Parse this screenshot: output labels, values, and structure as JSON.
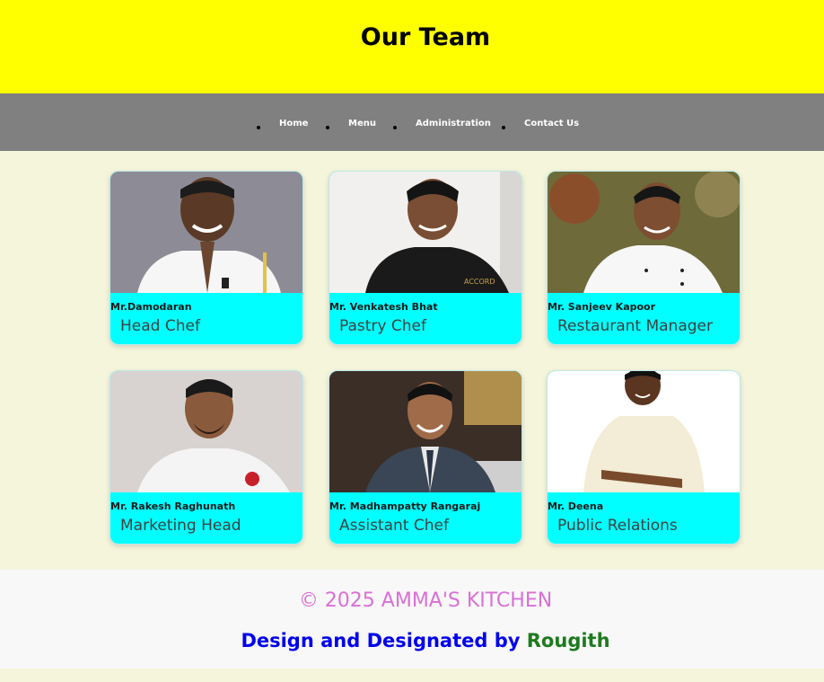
{
  "header": {
    "title": "Our Team",
    "background": "#ffff00"
  },
  "nav": {
    "background": "#808080",
    "items": [
      {
        "label": "Home"
      },
      {
        "label": "Menu"
      },
      {
        "label": "Administration"
      },
      {
        "label": "Contact Us"
      }
    ]
  },
  "team": [
    {
      "name": "Mr.Damodaran",
      "role": "Head Chef"
    },
    {
      "name": "Mr. Venkatesh Bhat",
      "role": "Pastry Chef"
    },
    {
      "name": "Mr. Sanjeev Kapoor",
      "role": "Restaurant Manager"
    },
    {
      "name": "Mr. Rakesh Raghunath",
      "role": "Marketing Head"
    },
    {
      "name": "Mr. Madhampatty Rangaraj",
      "role": "Assistant Chef"
    },
    {
      "name": "Mr. Deena",
      "role": "Public Relations"
    }
  ],
  "footer": {
    "copyright": "© 2025 AMMA'S KITCHEN",
    "credit_prefix": "Design and Designated by",
    "credit_author": "Rougith"
  },
  "colors": {
    "page_bg": "#f5f5dc",
    "card_bg": "#00ffff",
    "copyright": "#da70d6",
    "credit": "#0000ee",
    "author": "#1e7a1e"
  }
}
